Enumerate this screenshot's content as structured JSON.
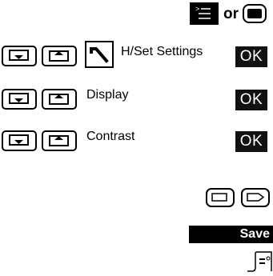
{
  "header": {
    "or_text": "or",
    "menu_key_icon": "menu-key-icon",
    "onhook_key_icon": "end-call-key-icon"
  },
  "rows": [
    {
      "label": "H/Set Settings",
      "ok": "OK",
      "icon": "wrench-icon"
    },
    {
      "label": "Display",
      "ok": "OK"
    },
    {
      "label": "Contrast",
      "ok": "OK"
    }
  ],
  "softkeys": {
    "left_icon": "left-softkey-icon",
    "right_icon": "right-softkey-icon"
  },
  "save_label": "Save",
  "footer_icon": "display-end-icon"
}
